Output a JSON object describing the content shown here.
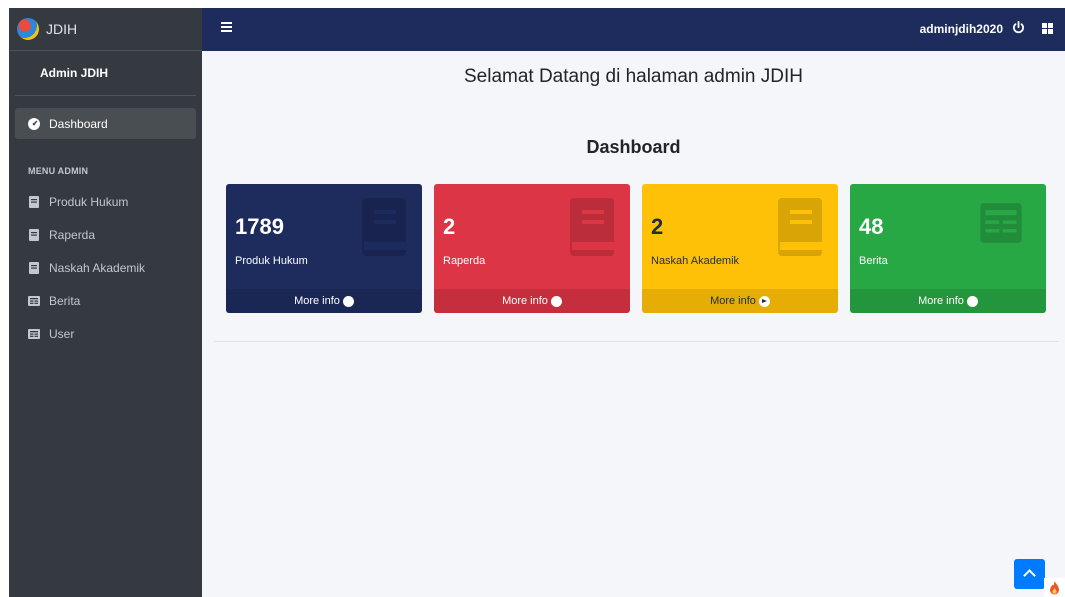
{
  "brand": {
    "name": "JDIH"
  },
  "user_panel": {
    "name": "Admin JDIH"
  },
  "sidebar": {
    "dashboard": "Dashboard",
    "header": "MENU ADMIN",
    "items": [
      {
        "label": "Produk Hukum",
        "icon": "book-icon"
      },
      {
        "label": "Raperda",
        "icon": "book-icon"
      },
      {
        "label": "Naskah Akademik",
        "icon": "book-icon"
      },
      {
        "label": "Berita",
        "icon": "newspaper-icon"
      },
      {
        "label": "User",
        "icon": "newspaper-icon"
      }
    ]
  },
  "topbar": {
    "username": "adminjdih2020"
  },
  "main": {
    "welcome": "Selamat Datang di halaman admin JDIH",
    "title": "Dashboard",
    "boxes": [
      {
        "value": "1789",
        "label": "Produk Hukum",
        "more": "More info",
        "color": "#1d2b5d",
        "icon": "book-icon"
      },
      {
        "value": "2",
        "label": "Raperda",
        "more": "More info",
        "color": "#dc3545",
        "icon": "book-icon"
      },
      {
        "value": "2",
        "label": "Naskah Akademik",
        "more": "More info",
        "color": "#ffc107",
        "icon": "book-icon"
      },
      {
        "value": "48",
        "label": "Berita",
        "more": "More info",
        "color": "#28a745",
        "icon": "newspaper-icon"
      }
    ]
  }
}
